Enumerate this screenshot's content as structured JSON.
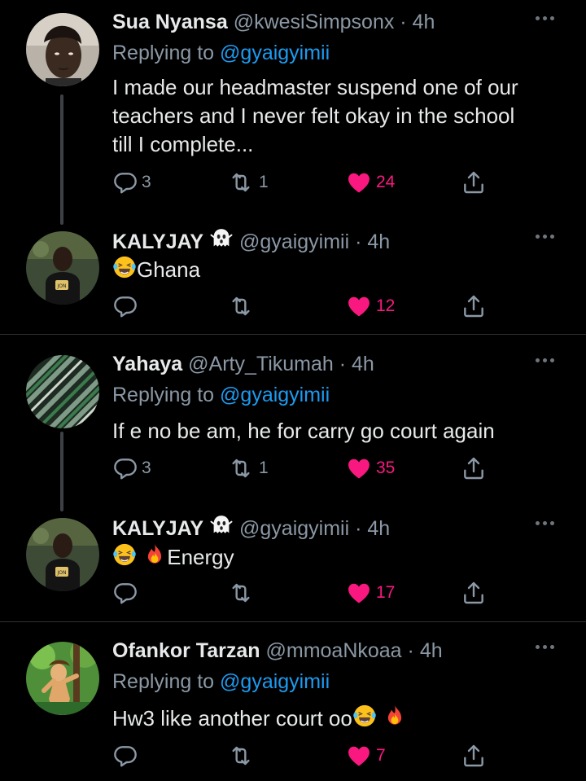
{
  "colors": {
    "background": "#000000",
    "text": "#e7e9ea",
    "muted": "#8b98a5",
    "link": "#1d9bf0",
    "like": "#f91880",
    "divider": "#2f3336"
  },
  "tweets": [
    {
      "name": "Sua Nyansa",
      "handle": "@kwesiSimpsonx",
      "time": "4h",
      "replying_prefix": "Replying to",
      "replying_to": "@gyaigyimii",
      "body_lines": [
        "I made our headmaster suspend one of our",
        "teachers and I never felt okay in the school",
        "till I complete..."
      ],
      "replies": "3",
      "retweets": "1",
      "likes": "24",
      "liked": true
    },
    {
      "name": "KALYJAY",
      "name_emoji": "ghost-emoji",
      "handle": "@gyaigyimii",
      "time": "4h",
      "body_text": "Ghana",
      "body_emojis": [
        "laughing-tears-emoji"
      ],
      "replies": "",
      "retweets": "",
      "likes": "12",
      "liked": true
    },
    {
      "name": "Yahaya",
      "handle": "@Arty_Tikumah",
      "time": "4h",
      "replying_prefix": "Replying to",
      "replying_to": "@gyaigyimii",
      "body_text": "If e no be am, he for carry go court again",
      "replies": "3",
      "retweets": "1",
      "likes": "35",
      "liked": true
    },
    {
      "name": "KALYJAY",
      "name_emoji": "ghost-emoji",
      "handle": "@gyaigyimii",
      "time": "4h",
      "body_text": "Energy",
      "body_emojis": [
        "laughing-tears-emoji",
        "fire-emoji"
      ],
      "replies": "",
      "retweets": "",
      "likes": "17",
      "liked": true
    },
    {
      "name": "Ofankor Tarzan",
      "handle": "@mmoaNkoaa",
      "time": "4h",
      "replying_prefix": "Replying to",
      "replying_to": "@gyaigyimii",
      "body_text": "Hw3 like another court oo",
      "body_emojis_after": [
        "laughing-tears-emoji",
        "fire-emoji"
      ],
      "replies": "",
      "retweets": "",
      "likes": "7",
      "liked": true
    }
  ]
}
